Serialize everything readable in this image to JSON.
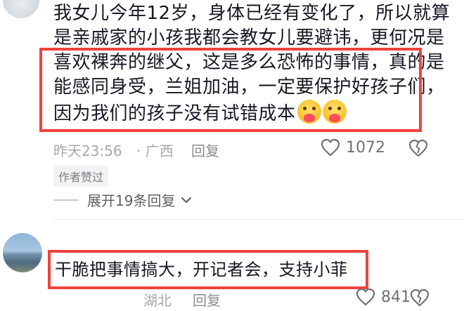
{
  "comment1": {
    "lines": [
      "我女儿今年12岁，身体已经有变化了，所以就算",
      "是亲戚家的小孩我都会教女儿要避讳，更何况是",
      "喜欢裸奔的继父，这是多么恐怖的事情，真的是",
      "能感同身受，兰姐加油，一定要保护好孩子们，",
      "因为我们的孩子没有试错成本"
    ],
    "time": "昨天23:56",
    "location": "· 广西",
    "reply_label": "回复",
    "like_count": "1072",
    "author_badge": "作者赞过",
    "expand_label": "展开19条回复"
  },
  "comment2": {
    "text": "干脆把事情搞大，开记者会，支持小菲",
    "time": "",
    "location": "湖北",
    "reply_label": "回复",
    "like_count": "841"
  },
  "colors": {
    "highlight_border": "#f0423c",
    "text_primary": "#161823",
    "text_meta": "#a7a8ad"
  },
  "icons": [
    "heart-outline-icon",
    "broken-heart-icon",
    "chevron-down-icon",
    "heart-face-emoji"
  ]
}
